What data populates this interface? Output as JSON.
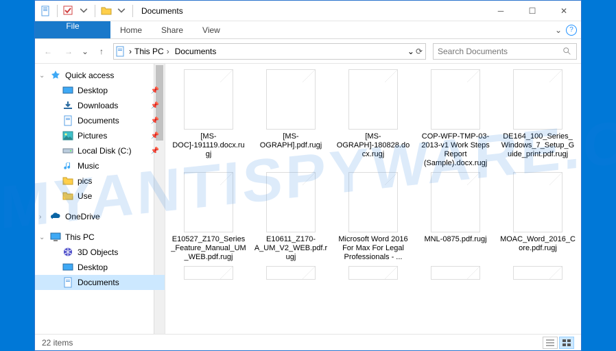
{
  "window": {
    "title": "Documents"
  },
  "ribbon": {
    "file": "File",
    "home": "Home",
    "share": "Share",
    "view": "View"
  },
  "breadcrumb": {
    "root": "This PC",
    "current": "Documents"
  },
  "search": {
    "placeholder": "Search Documents"
  },
  "sidebar": {
    "quick_access": {
      "label": "Quick access",
      "items": [
        {
          "label": "Desktop",
          "pinned": true
        },
        {
          "label": "Downloads",
          "pinned": true
        },
        {
          "label": "Documents",
          "pinned": true
        },
        {
          "label": "Pictures",
          "pinned": true
        },
        {
          "label": "Local Disk (C:)",
          "pinned": true
        },
        {
          "label": "Music",
          "pinned": false
        },
        {
          "label": "pics",
          "pinned": false
        },
        {
          "label": "Use",
          "pinned": false
        }
      ]
    },
    "onedrive": {
      "label": "OneDrive"
    },
    "this_pc": {
      "label": "This PC",
      "items": [
        {
          "label": "3D Objects"
        },
        {
          "label": "Desktop"
        },
        {
          "label": "Documents",
          "selected": true
        }
      ]
    }
  },
  "files": [
    {
      "name": "[MS-DOC]-191119.docx.rugj"
    },
    {
      "name": "[MS-OGRAPH].pdf.rugj"
    },
    {
      "name": "[MS-OGRAPH]-180828.docx.rugj"
    },
    {
      "name": "COP-WFP-TMP-03-2013-v1 Work Steps Report (Sample).docx.rugj"
    },
    {
      "name": "DE164_100_Series_Windows_7_Setup_Guide_print.pdf.rugj"
    },
    {
      "name": "E10527_Z170_Series_Feature_Manual_UM_WEB.pdf.rugj"
    },
    {
      "name": "E10611_Z170-A_UM_V2_WEB.pdf.rugj"
    },
    {
      "name": "Microsoft Word 2016 For Max For Legal Professionals - ..."
    },
    {
      "name": "MNL-0875.pdf.rugj"
    },
    {
      "name": "MOAC_Word_2016_Core.pdf.rugj"
    }
  ],
  "status": {
    "count": "22 items"
  },
  "watermark": "MYANTISPYWARE.COM"
}
